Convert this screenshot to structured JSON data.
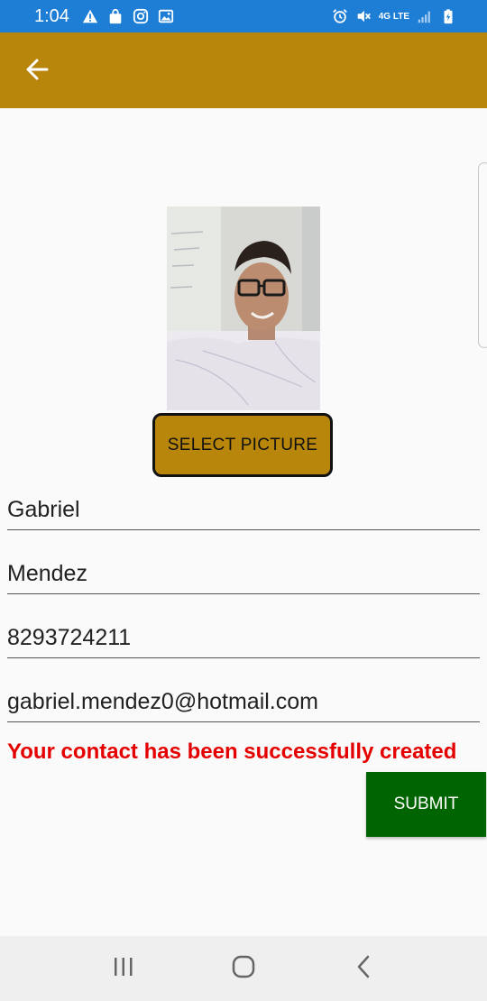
{
  "status_bar": {
    "time": "1:04",
    "network": "4G LTE"
  },
  "app_bar": {
    "color": "#b8860b"
  },
  "photo": {
    "alt": "Selected contact picture"
  },
  "select_button": {
    "label": "SELECT PICTURE"
  },
  "form": {
    "first_name": "Gabriel",
    "last_name": "Mendez",
    "phone": "8293724211",
    "email": "gabriel.mendez0@hotmail.com"
  },
  "message": {
    "text": "Your contact has been successfully created",
    "color": "#e50000"
  },
  "submit_button": {
    "label": "SUBMIT",
    "color": "#006400"
  },
  "colors": {
    "status_bar": "#1e7ed6",
    "background": "#fafafa",
    "nav_bar": "#efefef"
  }
}
